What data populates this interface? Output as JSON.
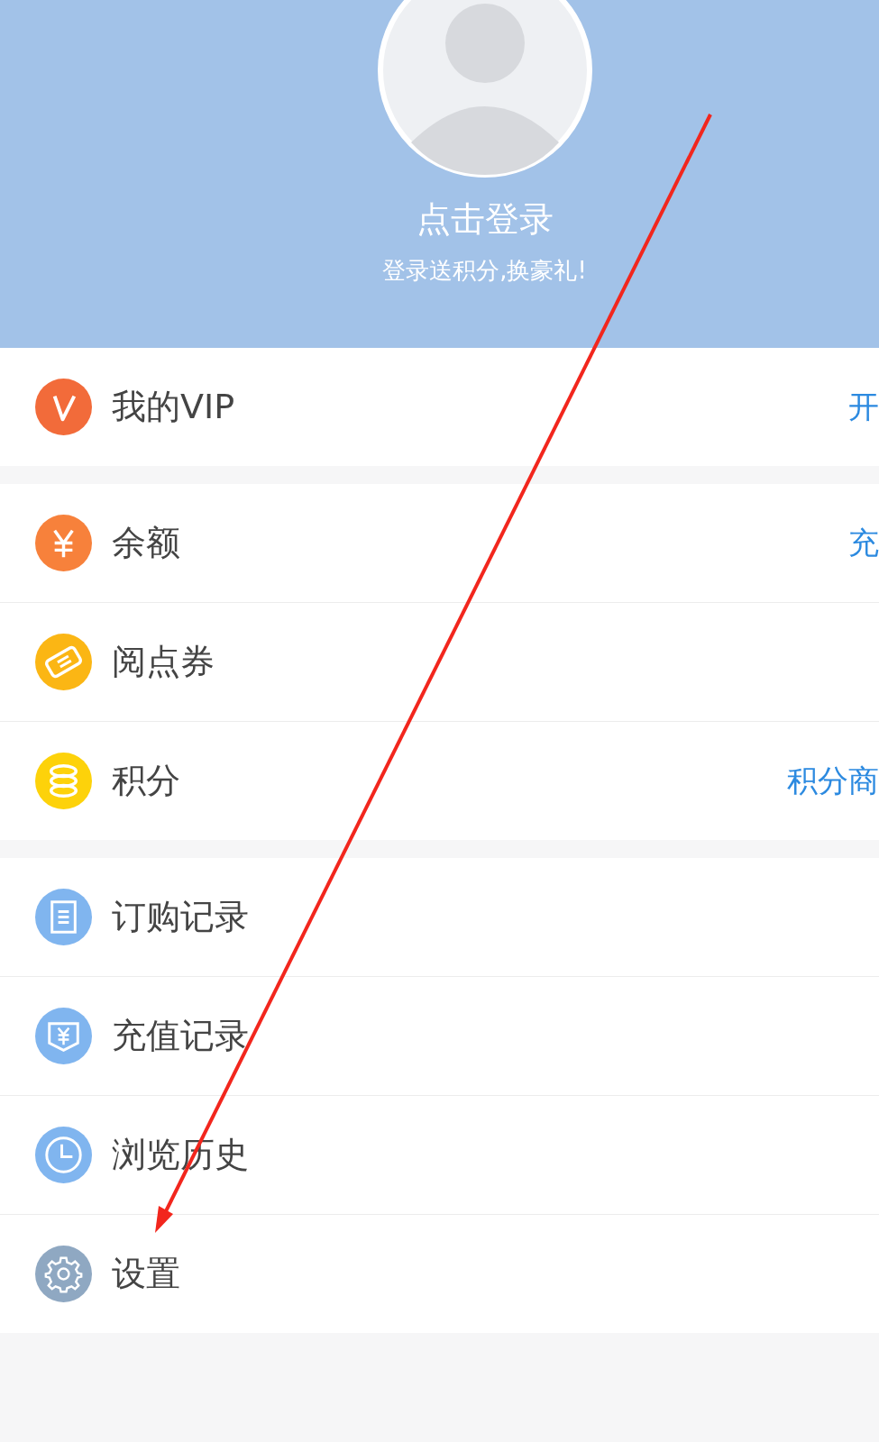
{
  "header": {
    "login_title": "点击登录",
    "login_subtitle": "登录送积分,换豪礼!"
  },
  "sections": [
    {
      "items": [
        {
          "kind": "vip",
          "label": "我的VIP",
          "action": "开"
        }
      ]
    },
    {
      "items": [
        {
          "kind": "yuan",
          "label": "余额",
          "action": "充"
        },
        {
          "kind": "ticket",
          "label": "阅点券"
        },
        {
          "kind": "coins",
          "label": "积分",
          "action": "积分商"
        }
      ]
    },
    {
      "items": [
        {
          "kind": "order",
          "label": "订购记录"
        },
        {
          "kind": "recharge",
          "label": "充值记录"
        },
        {
          "kind": "clock",
          "label": "浏览历史"
        },
        {
          "kind": "gear",
          "label": "设置"
        }
      ]
    }
  ],
  "annotation": {
    "kind": "arrow"
  }
}
